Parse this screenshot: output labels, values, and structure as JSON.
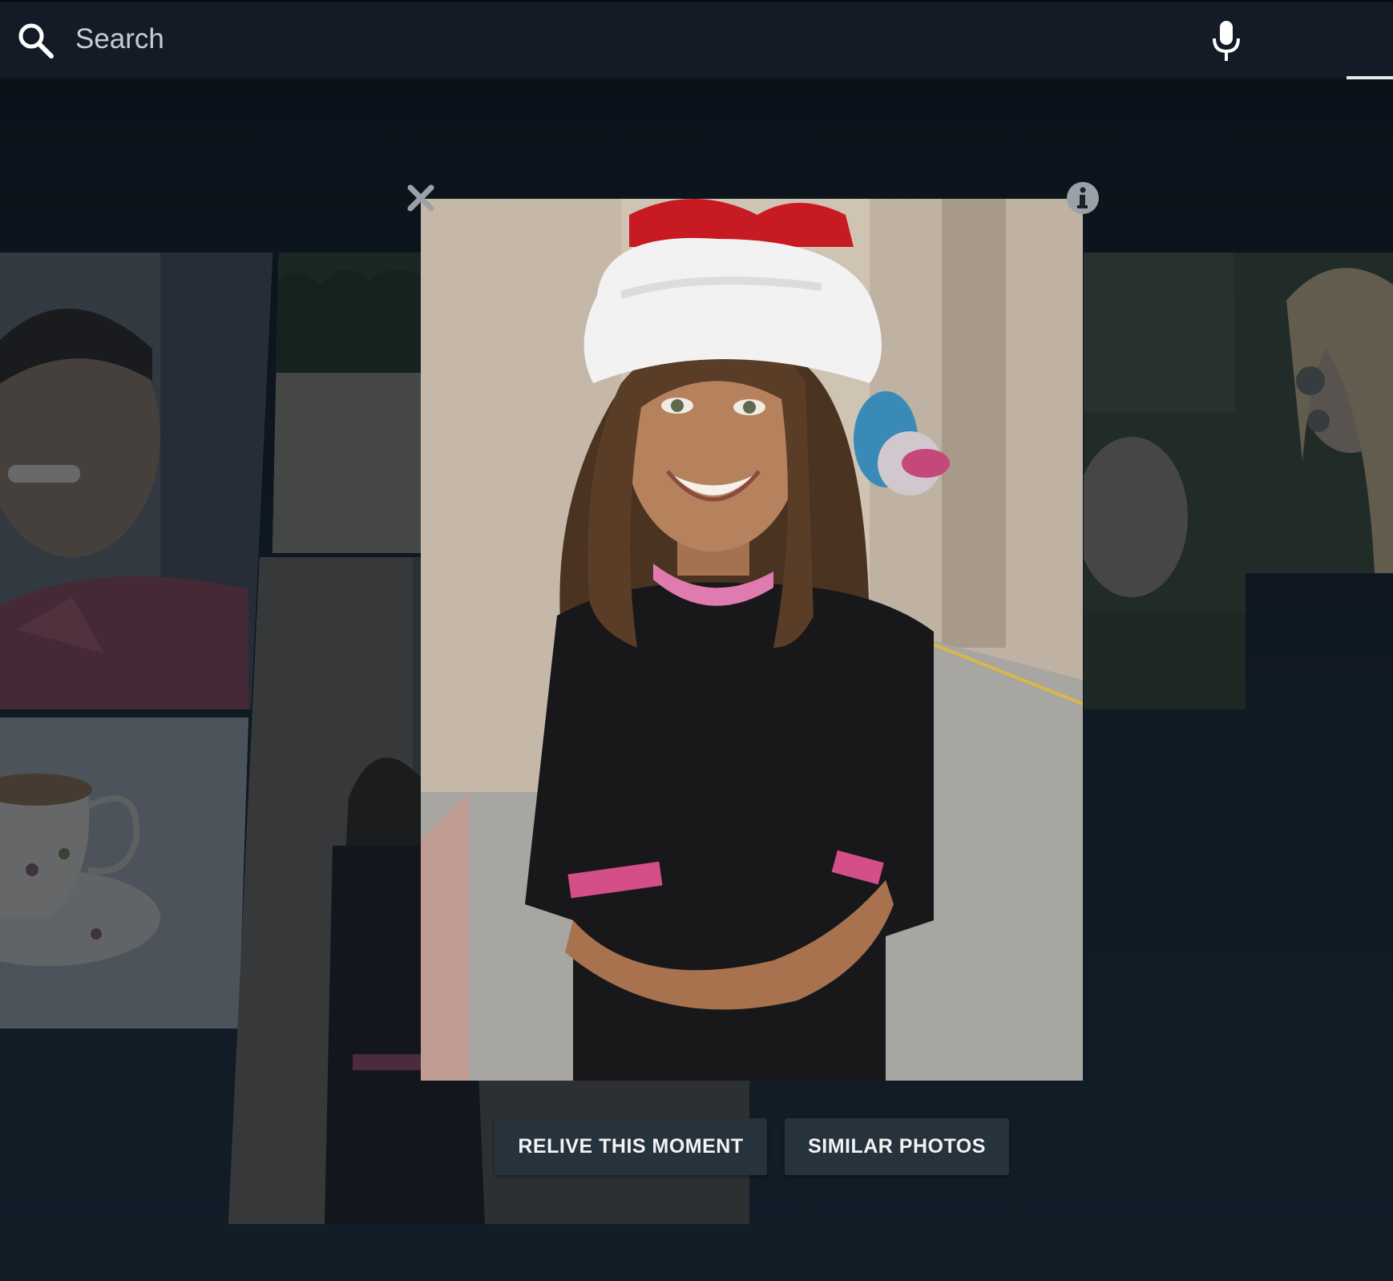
{
  "search": {
    "placeholder": "Search"
  },
  "icons": {
    "search": "search-icon",
    "mic": "microphone-icon",
    "close": "close-icon",
    "info": "info-icon"
  },
  "viewer": {
    "actions": {
      "relive_label": "RELIVE THIS MOMENT",
      "similar_label": "SIMILAR PHOTOS"
    }
  },
  "colors": {
    "background": "#0b121a",
    "searchbar": "#131c26",
    "button_bg": "#26323c",
    "button_text": "#f2f4f6"
  }
}
